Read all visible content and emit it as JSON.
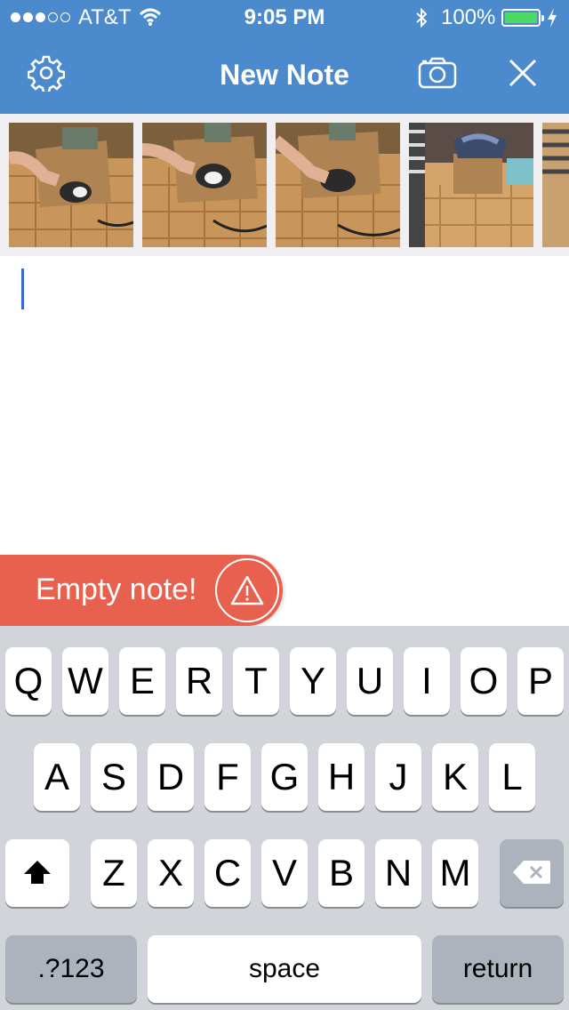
{
  "status_bar": {
    "carrier": "AT&T",
    "time": "9:05 PM",
    "battery": "100%",
    "signal_bars": 3,
    "signal_total": 5
  },
  "nav": {
    "title": "New Note",
    "settings_icon": "gear-icon",
    "camera_icon": "camera-icon",
    "close_icon": "close-icon"
  },
  "photos": [
    {
      "description": "person-with-box-and-kitten-1"
    },
    {
      "description": "person-with-box-and-kitten-2"
    },
    {
      "description": "person-with-box-and-kitten-3"
    },
    {
      "description": "box-with-clothes"
    },
    {
      "description": "partial-photo"
    }
  ],
  "editor": {
    "text": ""
  },
  "toast": {
    "text": "Empty note!",
    "icon": "warning-icon"
  },
  "keyboard": {
    "row1": [
      "Q",
      "W",
      "E",
      "R",
      "T",
      "Y",
      "U",
      "I",
      "O",
      "P"
    ],
    "row2": [
      "A",
      "S",
      "D",
      "F",
      "G",
      "H",
      "J",
      "K",
      "L"
    ],
    "row3": [
      "Z",
      "X",
      "C",
      "V",
      "B",
      "N",
      "M"
    ],
    "shift_icon": "shift-icon",
    "delete_icon": "delete-icon",
    "numbers_label": ".?123",
    "space_label": "space",
    "return_label": "return"
  },
  "colors": {
    "nav_bar": "#4a8acd",
    "toast": "#e8604e",
    "caret": "#3a64d8",
    "battery_fill": "#4cd964",
    "keyboard_bg": "#d1d4d9"
  }
}
